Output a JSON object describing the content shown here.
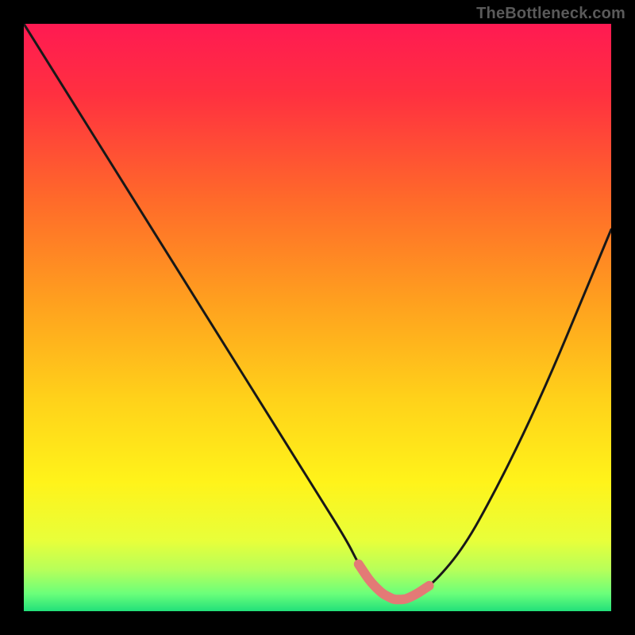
{
  "watermark": "TheBottleneck.com",
  "colors": {
    "frame": "#000000",
    "gradient_stops": [
      {
        "offset": 0.0,
        "color": "#ff1a52"
      },
      {
        "offset": 0.12,
        "color": "#ff3040"
      },
      {
        "offset": 0.3,
        "color": "#ff6a2a"
      },
      {
        "offset": 0.48,
        "color": "#ffa21e"
      },
      {
        "offset": 0.64,
        "color": "#ffd21a"
      },
      {
        "offset": 0.78,
        "color": "#fff31a"
      },
      {
        "offset": 0.88,
        "color": "#e8ff3a"
      },
      {
        "offset": 0.93,
        "color": "#b6ff5a"
      },
      {
        "offset": 0.97,
        "color": "#6bff7a"
      },
      {
        "offset": 1.0,
        "color": "#22e07a"
      }
    ],
    "curve": "#181818",
    "highlight": "#e37a76"
  },
  "chart_data": {
    "type": "line",
    "title": "",
    "xlabel": "",
    "ylabel": "",
    "xlim": [
      0,
      100
    ],
    "ylim": [
      0,
      100
    ],
    "grid": false,
    "series": [
      {
        "name": "bottleneck-curve",
        "x": [
          0,
          5,
          10,
          15,
          20,
          25,
          30,
          35,
          40,
          45,
          50,
          55,
          57,
          59,
          61,
          63,
          65,
          67,
          70,
          75,
          80,
          85,
          90,
          95,
          100
        ],
        "y": [
          100,
          92,
          84,
          76,
          68,
          60,
          52,
          44,
          36,
          28,
          20,
          12,
          8,
          5,
          3,
          2,
          2,
          3,
          5,
          11,
          20,
          30,
          41,
          53,
          65
        ]
      }
    ],
    "annotations": [
      {
        "name": "optimal-range-highlight",
        "x_range": [
          57,
          69
        ],
        "y_approx": 2
      }
    ],
    "note": "V-shaped bottleneck curve over rainbow performance gradient; minimum (optimal zone) near x≈63. Values estimated from pixels; no axis labels present."
  }
}
